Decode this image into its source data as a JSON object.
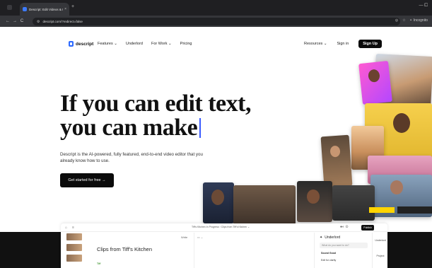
{
  "browser": {
    "tab_title": "Descript: Edit Videos & Podca...",
    "tab_close": "×",
    "new_tab": "+",
    "window_controls": "—   ⧠",
    "nav_back": "←",
    "nav_forward": "→",
    "nav_reload": "C",
    "url": "descript.com/?redirect=false",
    "incognito_label": "Incognito"
  },
  "site": {
    "logo_text": "descript",
    "nav": [
      "Features ⌄",
      "Underlord",
      "For Work ⌄",
      "Pricing"
    ],
    "resources": "Resources ⌄",
    "signin": "Sign in",
    "signup": "Sign Up"
  },
  "hero": {
    "line1": "If you can edit text,",
    "line2": "you can make",
    "subtitle": "Descript is the AI-powered, fully featured, end-to-end video editor that you already know how to use.",
    "cta": "Get started for free  →"
  },
  "app_preview": {
    "breadcrumb": "Tiff's Kitchen In Progress  ›  Clips from Tiff's Kitchen  ⌄",
    "publish": "Publish",
    "write": "Write",
    "clips_title": "Clips from Tiff's Kitchen",
    "speaker": "Tiff",
    "panel_title": "Underlord",
    "panel_search": "What do you want to do?",
    "panel_section": "Sound Good",
    "panel_item": "Edit for clarity",
    "rail_items": [
      "Underlord",
      "Project"
    ]
  }
}
